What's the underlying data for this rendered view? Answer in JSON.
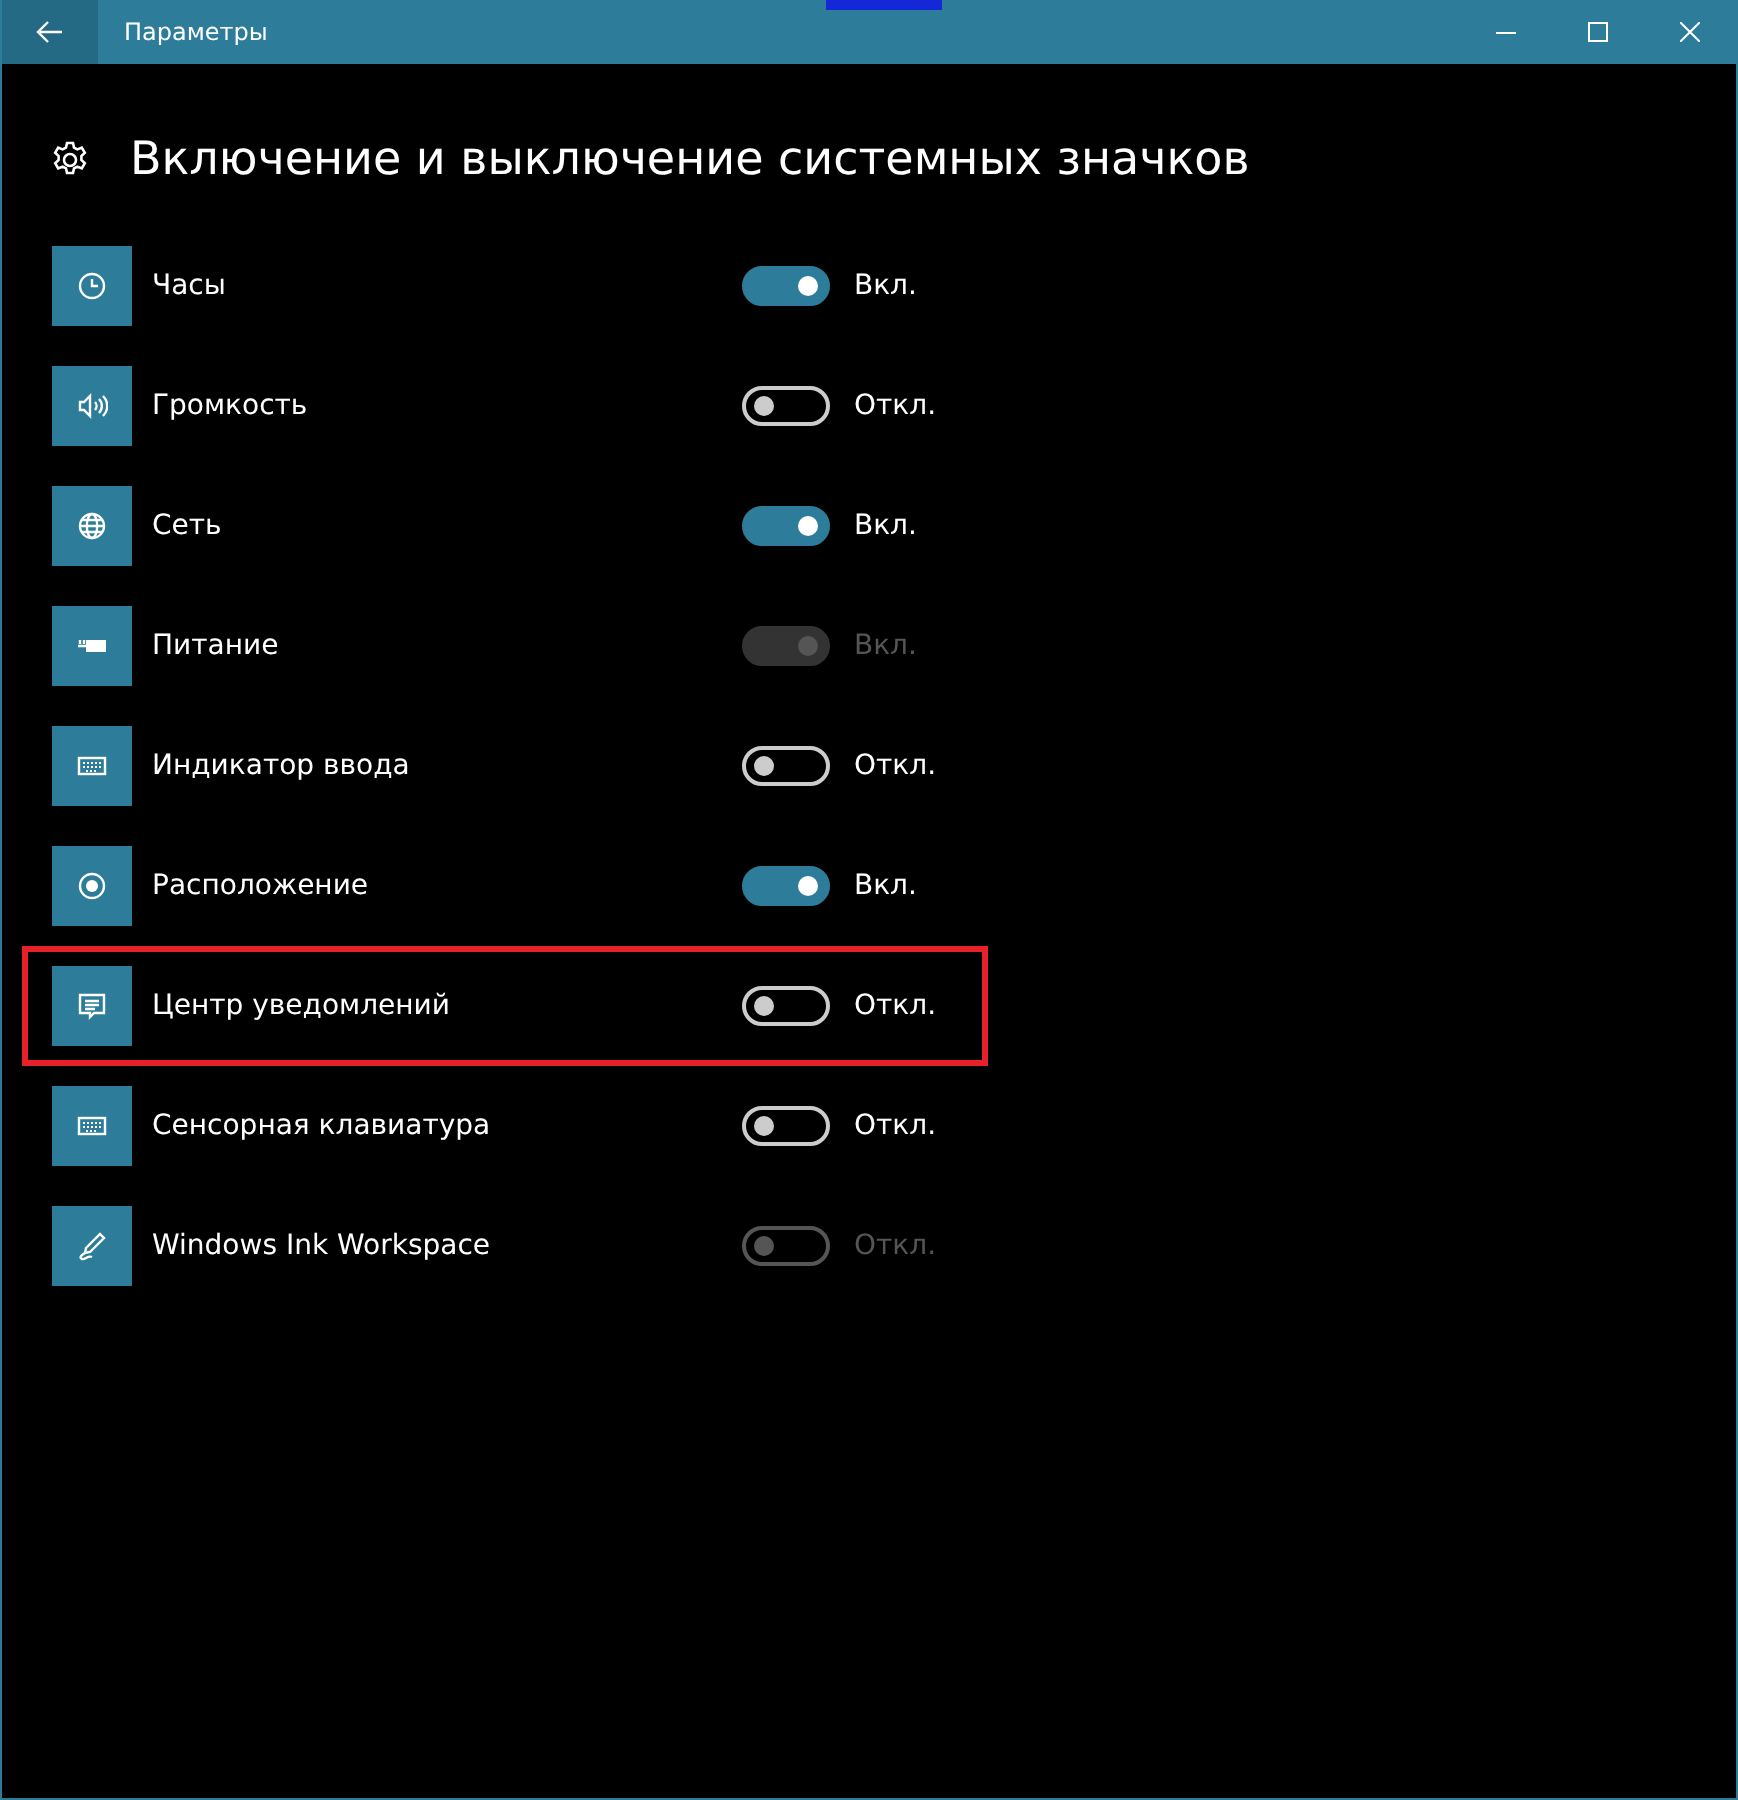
{
  "window": {
    "title": "Параметры"
  },
  "page": {
    "title": "Включение и выключение системных значков"
  },
  "items": [
    {
      "label": "Часы",
      "on": true,
      "disabled": false,
      "status": "Вкл.",
      "highlighted": false
    },
    {
      "label": "Громкость",
      "on": false,
      "disabled": false,
      "status": "Откл.",
      "highlighted": false
    },
    {
      "label": "Сеть",
      "on": true,
      "disabled": false,
      "status": "Вкл.",
      "highlighted": false
    },
    {
      "label": "Питание",
      "on": true,
      "disabled": true,
      "status": "Вкл.",
      "highlighted": false
    },
    {
      "label": "Индикатор ввода",
      "on": false,
      "disabled": false,
      "status": "Откл.",
      "highlighted": false
    },
    {
      "label": "Расположение",
      "on": true,
      "disabled": false,
      "status": "Вкл.",
      "highlighted": false
    },
    {
      "label": "Центр уведомлений",
      "on": false,
      "disabled": false,
      "status": "Откл.",
      "highlighted": true
    },
    {
      "label": "Сенсорная клавиатура",
      "on": false,
      "disabled": false,
      "status": "Откл.",
      "highlighted": false
    },
    {
      "label": "Windows Ink Workspace",
      "on": false,
      "disabled": true,
      "status": "Откл.",
      "highlighted": false
    }
  ]
}
